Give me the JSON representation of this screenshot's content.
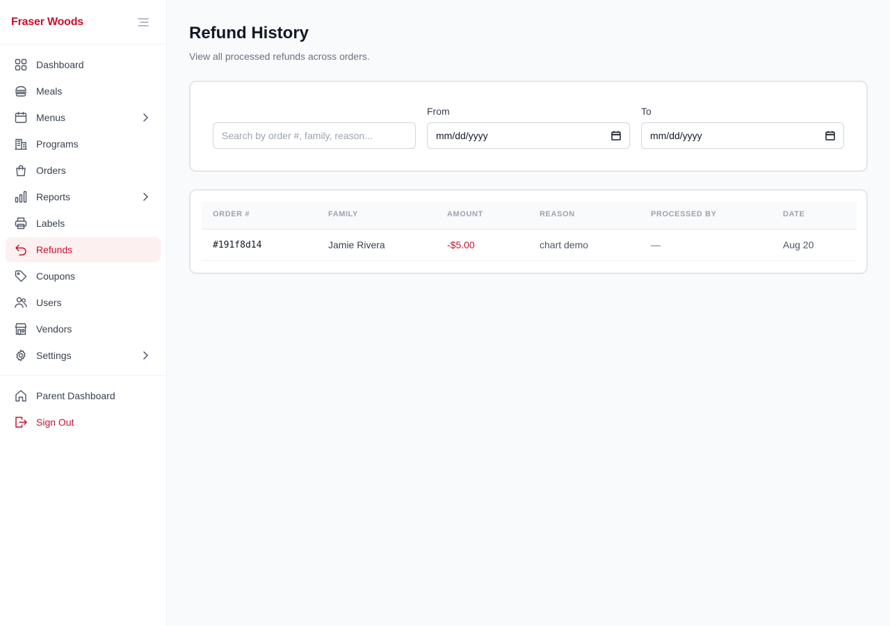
{
  "brand": {
    "name": "Fraser Woods",
    "color": "#c8102e"
  },
  "accent": "#c8102e",
  "active_bg": "#fdf0f1",
  "sidebar": {
    "items": [
      {
        "label": "Dashboard",
        "icon": "grid-icon",
        "chevron": false
      },
      {
        "label": "Meals",
        "icon": "burger-icon",
        "chevron": false
      },
      {
        "label": "Menus",
        "icon": "calendar-icon",
        "chevron": true
      },
      {
        "label": "Programs",
        "icon": "building-icon",
        "chevron": false
      },
      {
        "label": "Orders",
        "icon": "shopping-bag-icon",
        "chevron": false
      },
      {
        "label": "Reports",
        "icon": "bar-chart-icon",
        "chevron": true
      },
      {
        "label": "Labels",
        "icon": "printer-icon",
        "chevron": false
      },
      {
        "label": "Refunds",
        "icon": "undo-arrow-icon",
        "chevron": false,
        "active": true
      },
      {
        "label": "Coupons",
        "icon": "tag-icon",
        "chevron": false
      },
      {
        "label": "Users",
        "icon": "users-icon",
        "chevron": false
      },
      {
        "label": "Vendors",
        "icon": "store-icon",
        "chevron": false
      },
      {
        "label": "Settings",
        "icon": "gear-icon",
        "chevron": true
      }
    ],
    "bottom": [
      {
        "label": "Parent Dashboard",
        "icon": "home-icon"
      },
      {
        "label": "Sign Out",
        "icon": "sign-out-icon"
      }
    ]
  },
  "page": {
    "title": "Refund History",
    "subtitle": "View all processed refunds across orders."
  },
  "filters": {
    "search_placeholder": "Search by order #, family, reason...",
    "from_label": "From",
    "from_value": "mm/dd/yyyy",
    "to_label": "To",
    "to_value": "mm/dd/yyyy"
  },
  "table": {
    "headers": [
      "ORDER #",
      "FAMILY",
      "AMOUNT",
      "REASON",
      "PROCESSED BY",
      "DATE"
    ],
    "rows": [
      {
        "order": "#191f8d14",
        "family": "Jamie Rivera",
        "amount": "-$5.00",
        "reason": "chart demo",
        "processed_by": "—",
        "date": "Aug 20"
      }
    ]
  }
}
